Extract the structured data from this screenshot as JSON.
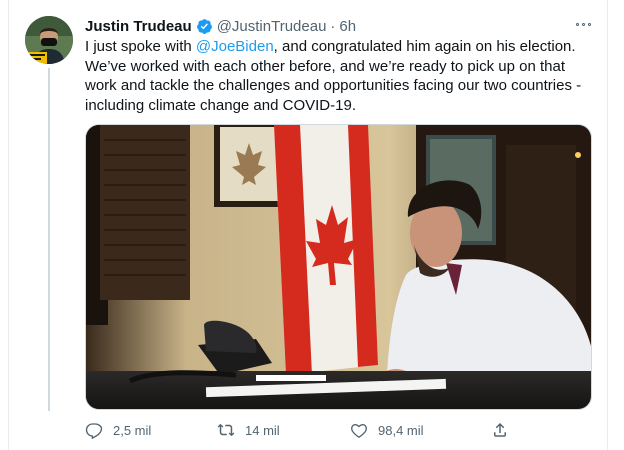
{
  "tweet": {
    "author_name": "Justin Trudeau",
    "handle": "@JustinTrudeau",
    "separator": "·",
    "time": "6h",
    "text_prefix": "I just spoke with ",
    "mention": "@JoeBiden",
    "text_suffix": ", and congratulated him again on his election. We’ve worked with each other before, and we’re ready to pick up on that work and tackle the challenges and opportunities facing our two countries - including climate change and COVID-19.",
    "accent_color": "#1d9bf0"
  },
  "actions": {
    "replies": "2,5 mil",
    "retweets": "14 mil",
    "likes": "98,4 mil"
  },
  "icons": {
    "verified": "verified-badge-icon",
    "more": "more-options-icon",
    "reply": "reply-icon",
    "retweet": "retweet-icon",
    "like": "heart-icon",
    "share": "share-icon"
  }
}
